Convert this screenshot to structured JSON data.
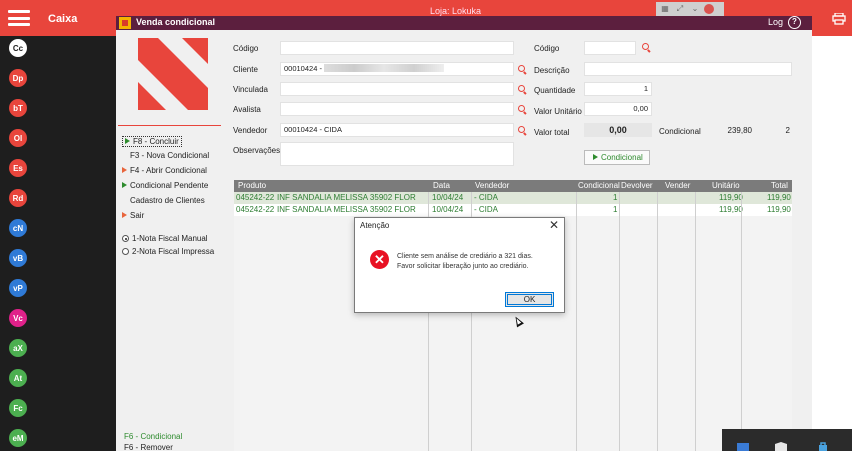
{
  "topbar": {
    "app_title": "Caixa",
    "store": "Loja: Lokuka"
  },
  "left_badges": [
    {
      "label": "Cc",
      "color": "#ffffff",
      "text": "#222222"
    },
    {
      "label": "Dp",
      "color": "#e8453c"
    },
    {
      "label": "bT",
      "color": "#e8453c"
    },
    {
      "label": "Ol",
      "color": "#e8453c"
    },
    {
      "label": "Es",
      "color": "#e8453c"
    },
    {
      "label": "Rd",
      "color": "#e8453c"
    },
    {
      "label": "cN",
      "color": "#2f7ad6"
    },
    {
      "label": "vB",
      "color": "#2f7ad6"
    },
    {
      "label": "vP",
      "color": "#2f7ad6"
    },
    {
      "label": "Vc",
      "color": "#e0218a"
    },
    {
      "label": "aX",
      "color": "#4caf50"
    },
    {
      "label": "At",
      "color": "#4caf50"
    },
    {
      "label": "Fc",
      "color": "#4caf50"
    },
    {
      "label": "eM",
      "color": "#4caf50"
    }
  ],
  "window": {
    "title": "Venda condicional",
    "log": "Log",
    "help": "?"
  },
  "menu": {
    "concluir": "F8 - Concluir",
    "nova": "F3 - Nova Condicional",
    "abrir": "F4 - Abrir Condicional",
    "pendente": "Condicional Pendente",
    "clientes": "Cadastro de Clientes",
    "sair": "Sair"
  },
  "radios": {
    "manual": "1-Nota Fiscal Manual",
    "impressa": "2-Nota Fiscal Impressa"
  },
  "footer": {
    "f6_cond": "F6 - Condicional",
    "f6_rem": "F6 - Remover"
  },
  "form": {
    "codigo_label": "Código",
    "cliente_label": "Cliente",
    "cliente_value": "00010424 -",
    "vinculada_label": "Vinculada",
    "avalista_label": "Avalista",
    "vendedor_label": "Vendedor",
    "vendedor_value": "00010424 - CIDA",
    "obs_label": "Observações",
    "codigo2_label": "Código",
    "descricao_label": "Descrição",
    "quantidade_label": "Quantidade",
    "quantidade_value": "1",
    "valor_unit_label": "Valor Unitário",
    "valor_unit_value": "0,00",
    "valor_total_label": "Valor total",
    "valor_total_value": "0,00",
    "condicional_label": "Condicional",
    "condicional_value": "239,80",
    "condicional_count": "2",
    "btn_condicional": "Condicional"
  },
  "grid": {
    "headers": [
      "Produto",
      "Data",
      "Vendedor",
      "Condicional",
      "Devolver",
      "Vender",
      "Unitário",
      "Total"
    ],
    "rows": [
      {
        "codigo": "045242-22",
        "produto": "INF SANDALIA MELISSA 35902 FLOR",
        "data": "10/04/24",
        "vendedor": "- CIDA",
        "condicional": "1",
        "unitario": "119,90",
        "total": "119,90"
      },
      {
        "codigo": "045242-22",
        "produto": "INF SANDALIA MELISSA 35902 FLOR",
        "data": "10/04/24",
        "vendedor": "- CIDA",
        "condicional": "1",
        "unitario": "119,90",
        "total": "119,90"
      }
    ]
  },
  "dialog": {
    "title": "Atenção",
    "line1": "Cliente sem análise de crediário a 321 dias.",
    "line2": "Favor solicitar liberação junto ao crediário.",
    "ok": "OK"
  },
  "colors": {
    "brand_red": "#e8453c",
    "window_title": "#5c1f3e",
    "green": "#2e8b2e"
  }
}
